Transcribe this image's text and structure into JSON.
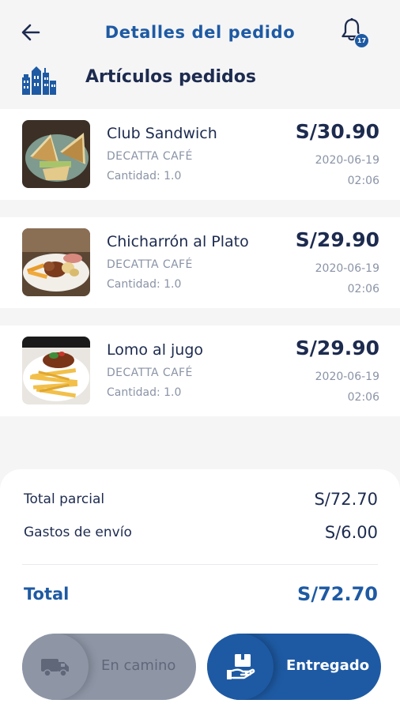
{
  "header": {
    "title": "Detalles del pedido",
    "back_icon": "arrow-left-icon",
    "notifications": {
      "icon": "bell-icon",
      "count": "17"
    }
  },
  "section": {
    "title": "Artículos pedidos",
    "icon": "city-buildings-icon"
  },
  "items": [
    {
      "name": "Club Sandwich",
      "shop": "DECATTA CAFÉ",
      "quantity": "Cantidad: 1.0",
      "price": "S/30.90",
      "date": "2020-06-19",
      "time": "02:06"
    },
    {
      "name": "Chicharrón al Plato",
      "shop": "DECATTA CAFÉ",
      "quantity": "Cantidad: 1.0",
      "price": "S/29.90",
      "date": "2020-06-19",
      "time": "02:06"
    },
    {
      "name": "Lomo al jugo",
      "shop": "DECATTA CAFÉ",
      "quantity": "Cantidad: 1.0",
      "price": "S/29.90",
      "date": "2020-06-19",
      "time": "02:06"
    }
  ],
  "summary": {
    "subtotal_label": "Total parcial",
    "subtotal_value": "S/72.70",
    "shipping_label": "Gastos de envío",
    "shipping_value": "S/6.00",
    "total_label": "Total",
    "total_value": "S/72.70"
  },
  "actions": {
    "on_the_way": {
      "label": "En camino",
      "icon": "delivery-truck-icon"
    },
    "delivered": {
      "label": "Entregado",
      "icon": "package-hand-icon"
    }
  },
  "colors": {
    "primary": "#1e5aa3",
    "text_dark": "#1d2b4f",
    "text_muted": "#8a93a6",
    "button_disabled": "#8e96a6",
    "background": "#f5f5f6"
  }
}
